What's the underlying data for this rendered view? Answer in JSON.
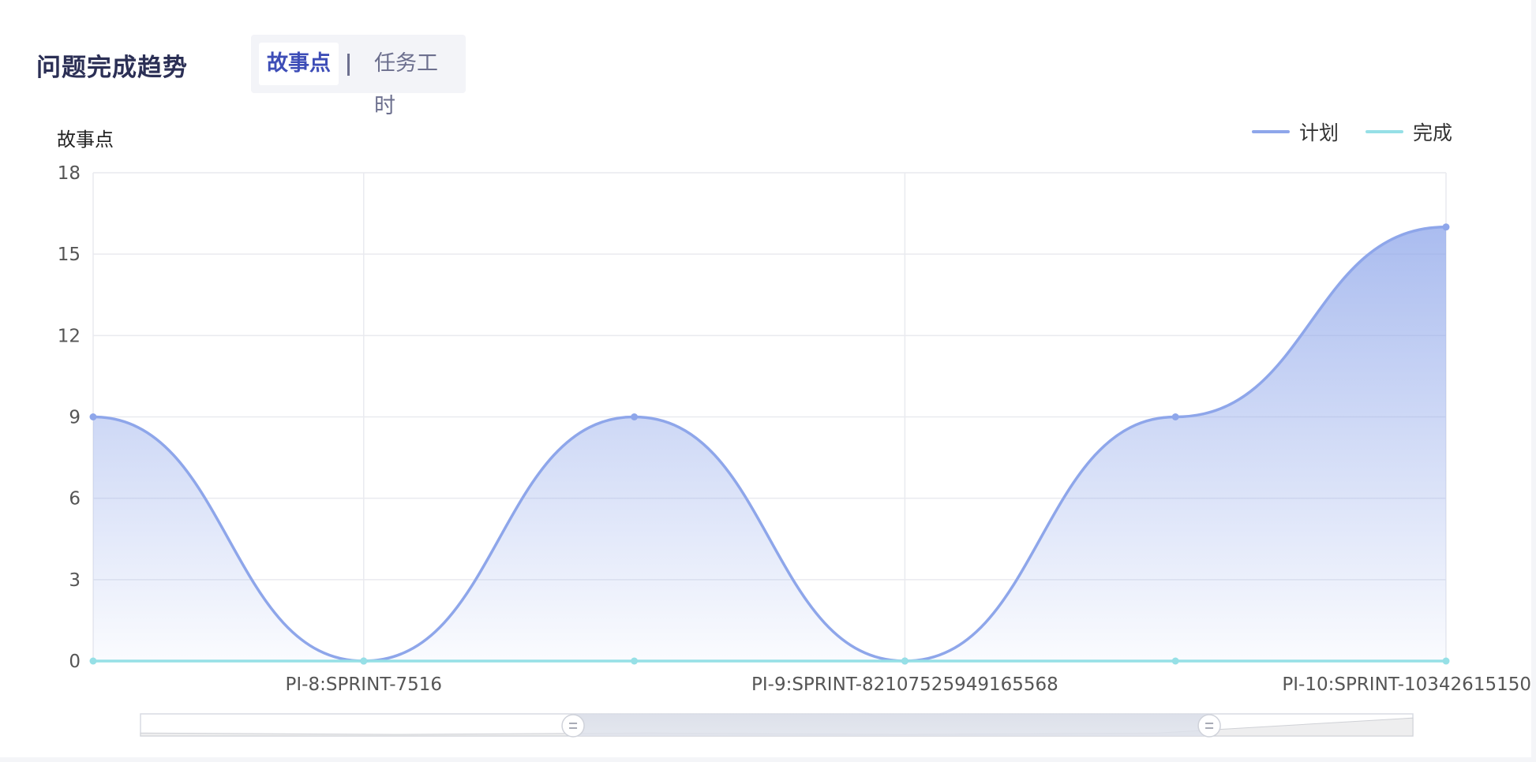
{
  "header": {
    "title": "问题完成趋势",
    "tabs": [
      {
        "label": "故事点",
        "active": true
      },
      {
        "label": "任务工时",
        "active": false
      }
    ]
  },
  "colors": {
    "plan": "#8ea6ea",
    "done": "#96e0e6",
    "accent": "#3d4db7"
  },
  "chart_data": {
    "type": "area",
    "ylabel": "故事点",
    "ylim": [
      0,
      18
    ],
    "yticks": [
      0,
      3,
      6,
      9,
      12,
      15,
      18
    ],
    "grid": true,
    "legend_position": "top-right",
    "x": [
      "",
      "PI-8:SPRINT-7516",
      "",
      "PI-9:SPRINT-82107525949165568",
      "",
      "PI-10:SPRINT-10342615150"
    ],
    "series": [
      {
        "name": "计划",
        "values": [
          9,
          0,
          9,
          0,
          9,
          16
        ]
      },
      {
        "name": "完成",
        "values": [
          0,
          0,
          0,
          0,
          0,
          0
        ]
      }
    ],
    "data_zoom": {
      "start": 0.34,
      "end": 0.84
    }
  }
}
